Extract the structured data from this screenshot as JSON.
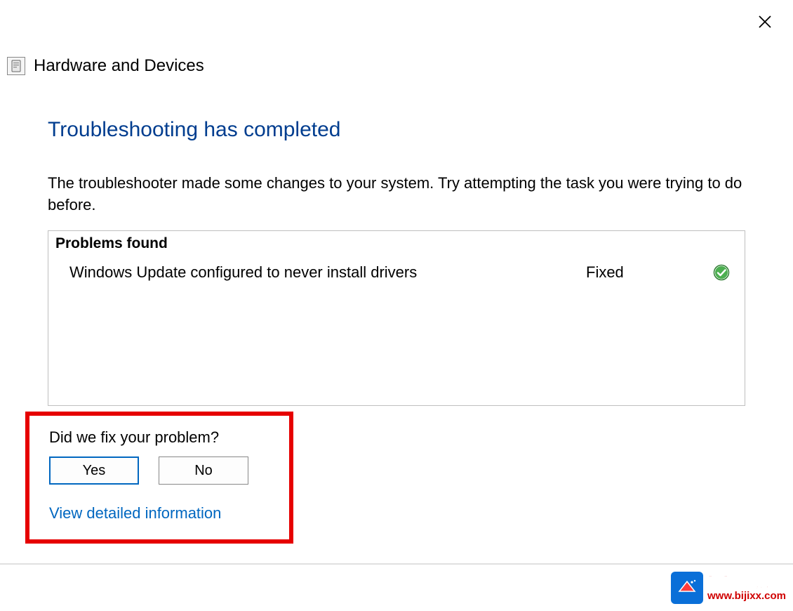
{
  "window": {
    "title": "Hardware and Devices"
  },
  "main": {
    "heading": "Troubleshooting has completed",
    "description": "The troubleshooter made some changes to your system. Try attempting the task you were trying to do before."
  },
  "problems": {
    "header": "Problems found",
    "items": [
      {
        "description": "Windows Update configured to never install drivers",
        "status": "Fixed",
        "icon": "check-circle"
      }
    ]
  },
  "feedback": {
    "question": "Did we fix your problem?",
    "yes_label": "Yes",
    "no_label": "No",
    "detail_link": "View detailed information"
  },
  "watermark": {
    "text_cn": "嘻嘻笔记",
    "url": "www.bijixx.com"
  },
  "colors": {
    "heading_blue": "#003d8f",
    "link_blue": "#0067c0",
    "highlight_red": "#e60000",
    "success_green": "#3bb54a"
  }
}
